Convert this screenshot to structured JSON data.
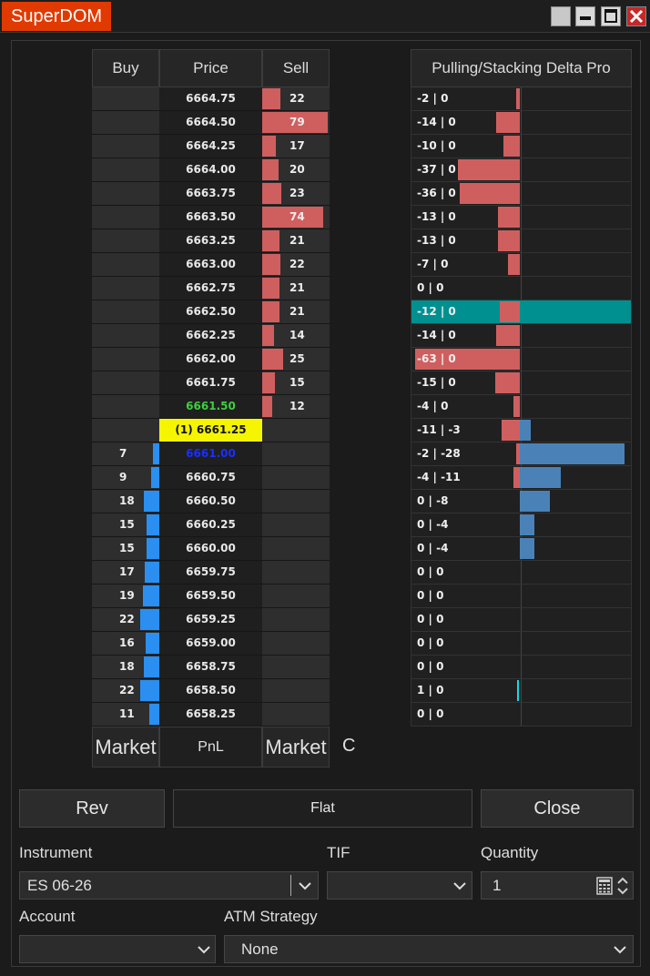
{
  "window": {
    "title": "SuperDOM"
  },
  "dom": {
    "headers": {
      "buy": "Buy",
      "price": "Price",
      "sell": "Sell"
    },
    "rows": [
      {
        "price": "6664.75",
        "buy": "",
        "sell": "22"
      },
      {
        "price": "6664.50",
        "buy": "",
        "sell": "79"
      },
      {
        "price": "6664.25",
        "buy": "",
        "sell": "17"
      },
      {
        "price": "6664.00",
        "buy": "",
        "sell": "20"
      },
      {
        "price": "6663.75",
        "buy": "",
        "sell": "23"
      },
      {
        "price": "6663.50",
        "buy": "",
        "sell": "74"
      },
      {
        "price": "6663.25",
        "buy": "",
        "sell": "21"
      },
      {
        "price": "6663.00",
        "buy": "",
        "sell": "22"
      },
      {
        "price": "6662.75",
        "buy": "",
        "sell": "21"
      },
      {
        "price": "6662.50",
        "buy": "",
        "sell": "21"
      },
      {
        "price": "6662.25",
        "buy": "",
        "sell": "14"
      },
      {
        "price": "6662.00",
        "buy": "",
        "sell": "25"
      },
      {
        "price": "6661.75",
        "buy": "",
        "sell": "15"
      },
      {
        "price": "6661.50",
        "buy": "",
        "sell": "12",
        "price_color": "#3ecf3e"
      },
      {
        "price": "(1) 6661.25",
        "buy": "",
        "sell": "",
        "highlight": true
      },
      {
        "price": "6661.00",
        "buy": "7",
        "sell": "",
        "price_color": "#1a2fff"
      },
      {
        "price": "6660.75",
        "buy": "9",
        "sell": ""
      },
      {
        "price": "6660.50",
        "buy": "18",
        "sell": ""
      },
      {
        "price": "6660.25",
        "buy": "15",
        "sell": ""
      },
      {
        "price": "6660.00",
        "buy": "15",
        "sell": ""
      },
      {
        "price": "6659.75",
        "buy": "17",
        "sell": ""
      },
      {
        "price": "6659.50",
        "buy": "19",
        "sell": ""
      },
      {
        "price": "6659.25",
        "buy": "22",
        "sell": ""
      },
      {
        "price": "6659.00",
        "buy": "16",
        "sell": ""
      },
      {
        "price": "6658.75",
        "buy": "18",
        "sell": ""
      },
      {
        "price": "6658.50",
        "buy": "22",
        "sell": ""
      },
      {
        "price": "6658.25",
        "buy": "11",
        "sell": ""
      }
    ],
    "footer": {
      "buy_market": "Market",
      "pnl": "PnL",
      "sell_market": "Market",
      "c_label": "C"
    }
  },
  "delta_pro": {
    "title": "Pulling/Stacking Delta Pro",
    "rows": [
      {
        "label": "-2 | 0",
        "pull": -2,
        "stack": 0
      },
      {
        "label": "-14 | 0",
        "pull": -14,
        "stack": 0
      },
      {
        "label": "-10 | 0",
        "pull": -10,
        "stack": 0
      },
      {
        "label": "-37 | 0",
        "pull": -37,
        "stack": 0
      },
      {
        "label": "-36 | 0",
        "pull": -36,
        "stack": 0
      },
      {
        "label": "-13 | 0",
        "pull": -13,
        "stack": 0
      },
      {
        "label": "-13 | 0",
        "pull": -13,
        "stack": 0
      },
      {
        "label": "-7 | 0",
        "pull": -7,
        "stack": 0
      },
      {
        "label": "0 | 0",
        "pull": 0,
        "stack": 0
      },
      {
        "label": "-12 | 0",
        "pull": -12,
        "stack": 0,
        "highlight": true
      },
      {
        "label": "-14 | 0",
        "pull": -14,
        "stack": 0
      },
      {
        "label": "-63 | 0",
        "pull": -63,
        "stack": 0
      },
      {
        "label": "-15 | 0",
        "pull": -15,
        "stack": 0
      },
      {
        "label": "-4 | 0",
        "pull": -4,
        "stack": 0
      },
      {
        "label": "-11 | -3",
        "pull": -11,
        "stack": -3
      },
      {
        "label": "-2 | -28",
        "pull": -2,
        "stack": -28
      },
      {
        "label": "-4 | -11",
        "pull": -4,
        "stack": -11
      },
      {
        "label": "0 | -8",
        "pull": 0,
        "stack": -8
      },
      {
        "label": "0 | -4",
        "pull": 0,
        "stack": -4
      },
      {
        "label": "0 | -4",
        "pull": 0,
        "stack": -4
      },
      {
        "label": "0 | 0",
        "pull": 0,
        "stack": 0
      },
      {
        "label": "0 | 0",
        "pull": 0,
        "stack": 0
      },
      {
        "label": "0 | 0",
        "pull": 0,
        "stack": 0
      },
      {
        "label": "0 | 0",
        "pull": 0,
        "stack": 0
      },
      {
        "label": "0 | 0",
        "pull": 0,
        "stack": 0
      },
      {
        "label": "1 | 0",
        "pull": 1,
        "stack": 0
      },
      {
        "label": "0 | 0",
        "pull": 0,
        "stack": 0
      }
    ]
  },
  "controls": {
    "rev": "Rev",
    "flat": "Flat",
    "close": "Close",
    "instrument_label": "Instrument",
    "instrument_value": "ES 06-26",
    "tif_label": "TIF",
    "tif_value": "",
    "quantity_label": "Quantity",
    "quantity_value": "1",
    "account_label": "Account",
    "account_value": "",
    "atm_label": "ATM Strategy",
    "atm_value": "None"
  },
  "colors": {
    "title_bg": "#e13a00",
    "sell_bar": "#cf5f5f",
    "buy_bar": "#2a8ff0",
    "last_price_bg": "#f5f500",
    "delta_highlight": "#009090",
    "stack_bar": "#4a82b8"
  }
}
